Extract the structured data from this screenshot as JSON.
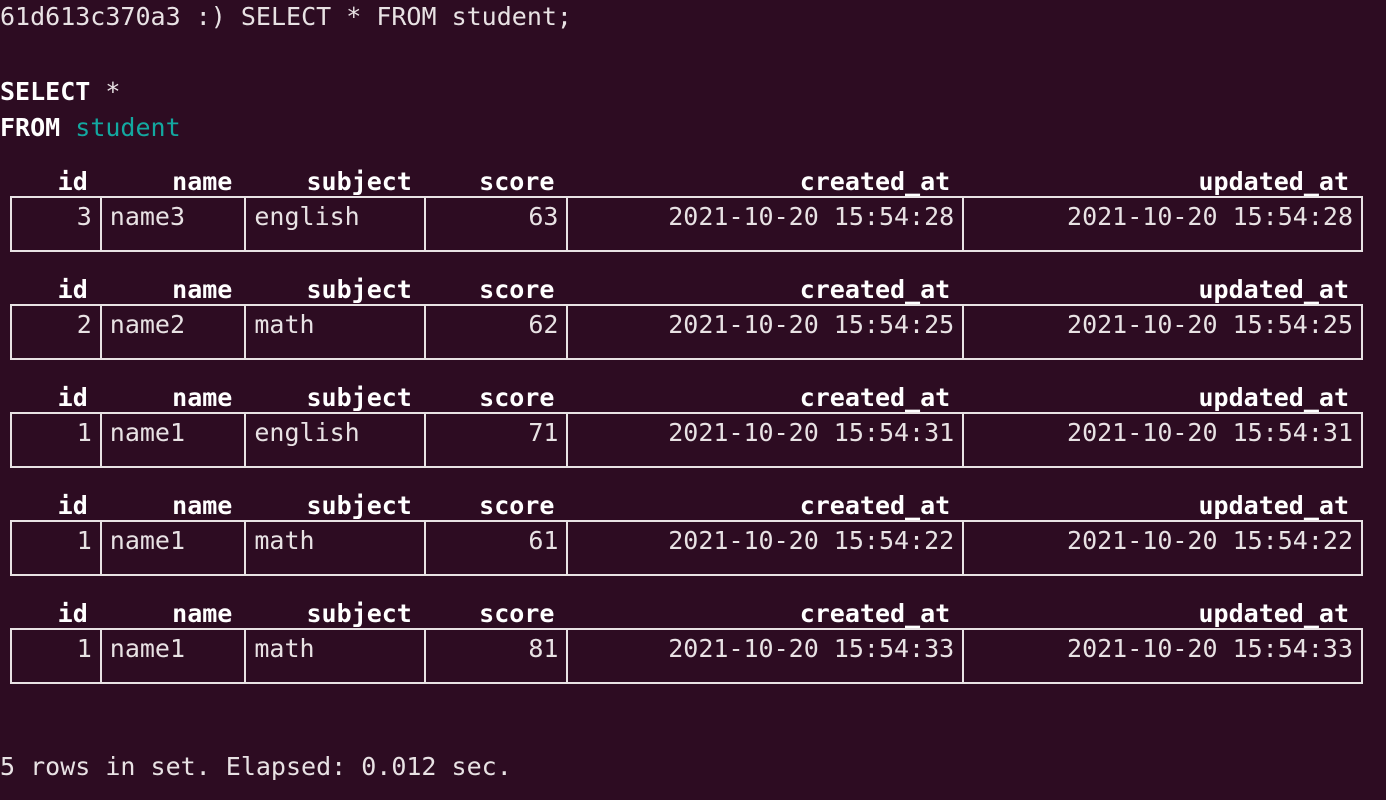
{
  "terminal": {
    "background_color": "#2d0c22",
    "foreground_color": "#e8e2e4",
    "keyword_color": "#ffffff",
    "identifier_color": "#13a8a0"
  },
  "prompt": {
    "host": "61d613c370a3",
    "sigil": ":)",
    "command": "SELECT * FROM student;",
    "full_line": "61d613c370a3 :) SELECT * FROM student;"
  },
  "query_echo": {
    "line1_keyword": "SELECT",
    "line1_operator": "*",
    "line2_keyword": "FROM",
    "line2_identifier": "student"
  },
  "table": {
    "columns": [
      {
        "key": "id",
        "header": "id",
        "align": "right"
      },
      {
        "key": "name",
        "header": "name",
        "align": "left"
      },
      {
        "key": "subject",
        "header": "subject",
        "align": "left"
      },
      {
        "key": "score",
        "header": "score",
        "align": "right"
      },
      {
        "key": "created_at",
        "header": "created_at",
        "align": "right"
      },
      {
        "key": "updated_at",
        "header": "updated_at",
        "align": "right"
      }
    ],
    "rows": [
      {
        "id": "3",
        "name": "name3",
        "subject": "english",
        "score": "63",
        "created_at": "2021-10-20 15:54:28",
        "updated_at": "2021-10-20 15:54:28"
      },
      {
        "id": "2",
        "name": "name2",
        "subject": "math",
        "score": "62",
        "created_at": "2021-10-20 15:54:25",
        "updated_at": "2021-10-20 15:54:25"
      },
      {
        "id": "1",
        "name": "name1",
        "subject": "english",
        "score": "71",
        "created_at": "2021-10-20 15:54:31",
        "updated_at": "2021-10-20 15:54:31"
      },
      {
        "id": "1",
        "name": "name1",
        "subject": "math",
        "score": "61",
        "created_at": "2021-10-20 15:54:22",
        "updated_at": "2021-10-20 15:54:22"
      },
      {
        "id": "1",
        "name": "name1",
        "subject": "math",
        "score": "81",
        "created_at": "2021-10-20 15:54:33",
        "updated_at": "2021-10-20 15:54:33"
      }
    ]
  },
  "status": {
    "row_count": "5",
    "text": "5 rows in set. Elapsed: 0.012 sec."
  }
}
